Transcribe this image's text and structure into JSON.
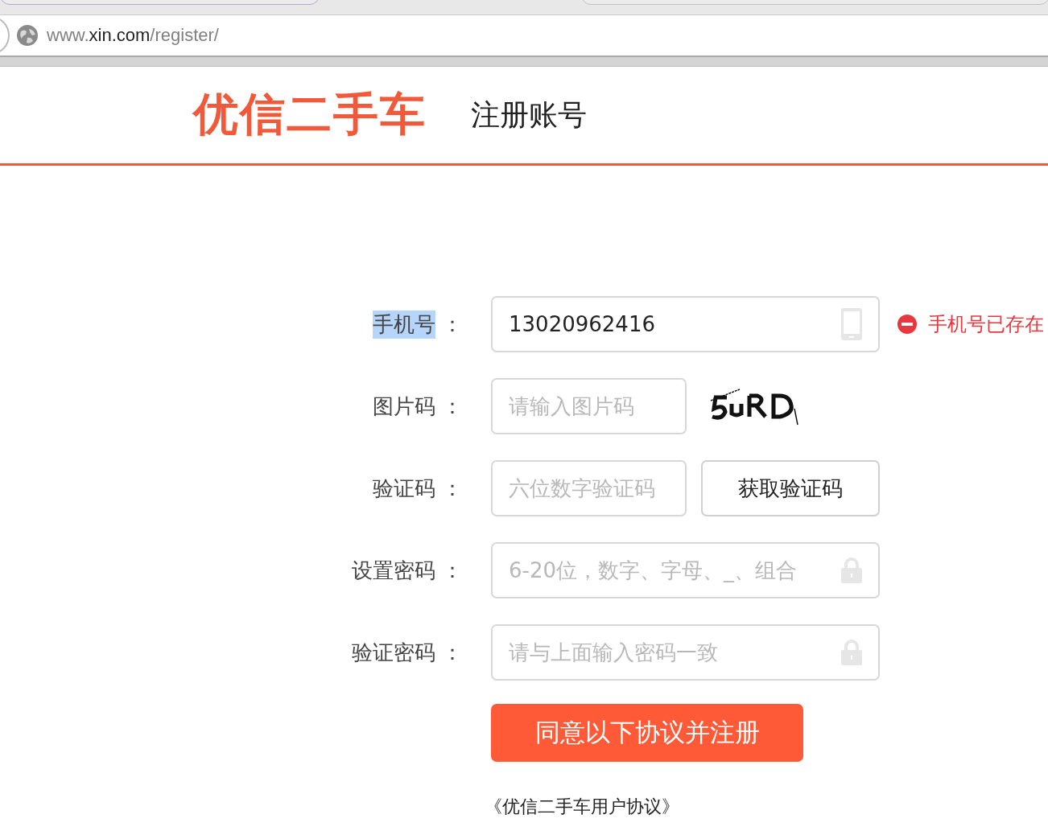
{
  "browser": {
    "url": {
      "prefix": "www.",
      "domain": "xin.com",
      "path": "/register/"
    }
  },
  "header": {
    "logo": "优信二手车",
    "title": "注册账号"
  },
  "fields": [
    {
      "kind": "phone",
      "label": "手机号",
      "label_highlighted": true,
      "colon": "：",
      "value": "13020962416",
      "error": "手机号已存在"
    },
    {
      "kind": "captcha",
      "label": "图片码",
      "label_highlighted": false,
      "colon": "：",
      "placeholder": "请输入图片码"
    },
    {
      "kind": "sms",
      "label": "验证码",
      "label_highlighted": false,
      "colon": "：",
      "placeholder": "六位数字验证码",
      "button": "获取验证码"
    },
    {
      "kind": "password",
      "label": "设置密码",
      "label_highlighted": false,
      "colon": "：",
      "placeholder": "6-20位，数字、字母、_、组合"
    },
    {
      "kind": "password",
      "label": "验证密码",
      "label_highlighted": false,
      "colon": "：",
      "placeholder": "请与上面输入密码一致"
    }
  ],
  "submit": "同意以下协议并注册",
  "agreement": "《优信二手车用户协议》"
}
